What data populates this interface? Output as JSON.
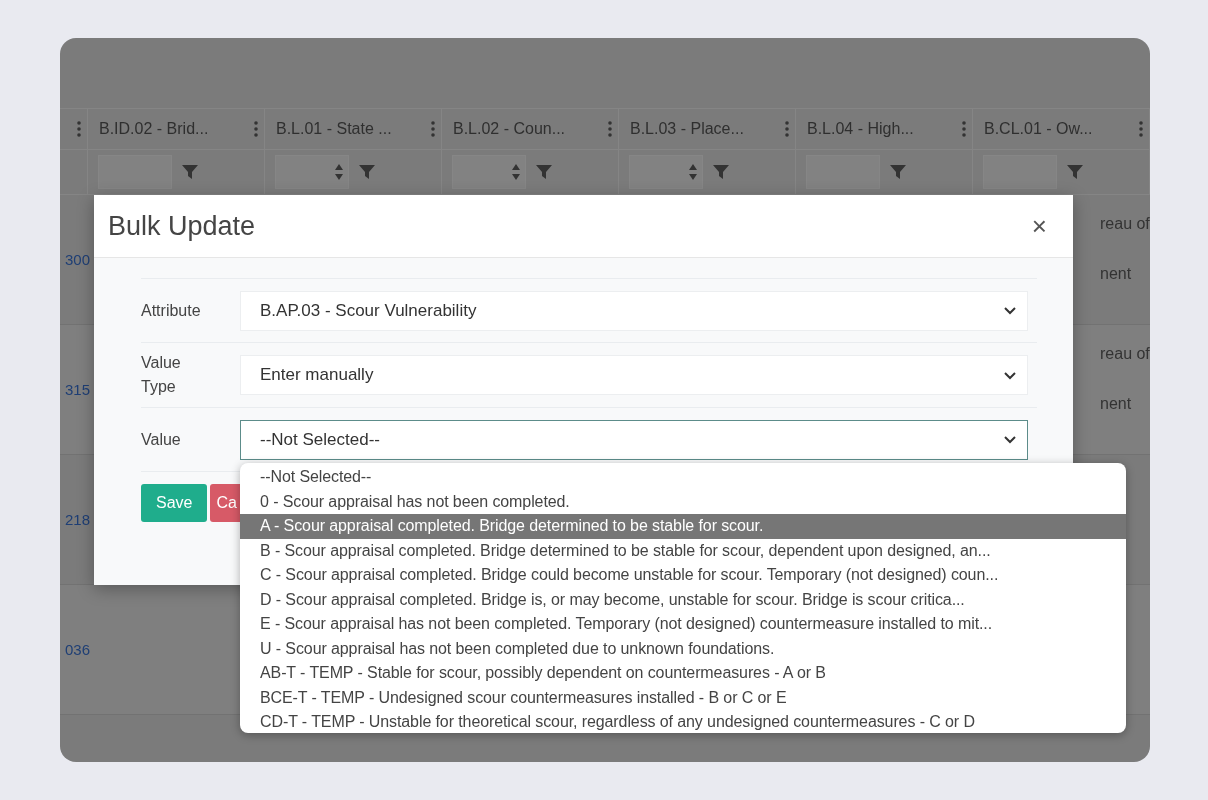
{
  "table": {
    "columns": [
      {
        "label": "B.ID.02 - Brid...",
        "spinner": false
      },
      {
        "label": "B.L.01 - State ...",
        "spinner": true
      },
      {
        "label": "B.L.02 - Coun...",
        "spinner": true
      },
      {
        "label": "B.L.03 - Place...",
        "spinner": true
      },
      {
        "label": "B.L.04 - High...",
        "spinner": false
      },
      {
        "label": "B.CL.01 - Ow...",
        "spinner": false
      }
    ],
    "rows": [
      {
        "id": "300",
        "column_6": [
          "reau of",
          "nent"
        ]
      },
      {
        "id": "315",
        "column_6": [
          "reau of",
          "nent"
        ]
      },
      {
        "id": "218"
      },
      {
        "id": "036"
      }
    ]
  },
  "modal": {
    "title": "Bulk Update",
    "close": "×",
    "fields": [
      {
        "label": "Attribute",
        "value": "B.AP.03 - Scour Vulnerability",
        "focused": false
      },
      {
        "label": "Value Type",
        "value": "Enter manually",
        "focused": false
      },
      {
        "label": "Value",
        "value": "--Not Selected--",
        "focused": true
      }
    ],
    "buttons": [
      {
        "label": "Save",
        "kind": "primary"
      },
      {
        "label": "Ca",
        "kind": "danger"
      }
    ]
  },
  "dropdown": {
    "options": [
      {
        "label": "--Not Selected--",
        "selected": false
      },
      {
        "label": "0 - Scour appraisal has not been completed.",
        "selected": false
      },
      {
        "label": "A - Scour appraisal completed. Bridge determined to be stable for scour.",
        "selected": true
      },
      {
        "label": "B - Scour appraisal completed. Bridge determined to be stable for scour, dependent upon designed, an...",
        "selected": false
      },
      {
        "label": "C - Scour appraisal completed. Bridge could become unstable for scour. Temporary (not designed) coun...",
        "selected": false
      },
      {
        "label": "D - Scour appraisal completed. Bridge is, or may become, unstable for scour. Bridge is scour critica...",
        "selected": false
      },
      {
        "label": "E - Scour appraisal has not been completed. Temporary (not designed) countermeasure installed to mit...",
        "selected": false
      },
      {
        "label": "U - Scour appraisal has not been completed due to unknown foundations.",
        "selected": false
      },
      {
        "label": "AB-T - TEMP - Stable for scour, possibly dependent on countermeasures - A or B",
        "selected": false
      },
      {
        "label": "BCE-T - TEMP - Undesigned scour countermeasures installed - B or C or E",
        "selected": false
      },
      {
        "label": "CD-T - TEMP - Unstable for theoretical scour, regardless of any undesigned countermeasures - C or D",
        "selected": false
      }
    ]
  }
}
